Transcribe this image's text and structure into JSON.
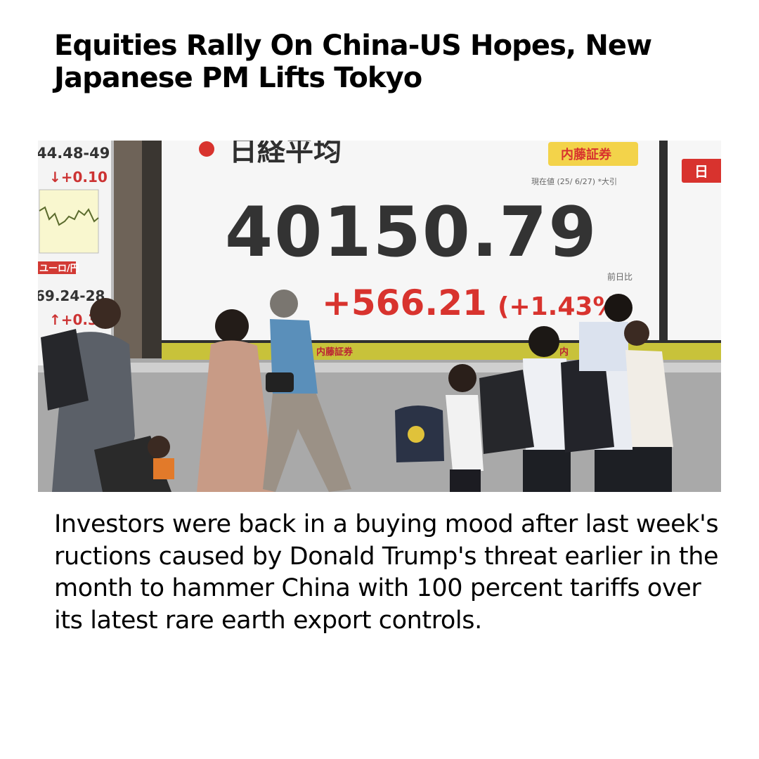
{
  "headline": "Equities Rally On China-US Hopes, New Japanese PM Lifts Tokyo",
  "photo": {
    "main_board": {
      "index_name": "日経平均",
      "broker_badge": "内藤証券",
      "timestamp": "現在値 (25/ 6/27) *大引",
      "value": "40150.79",
      "prev_day_label": "前日比",
      "change": "+566.21",
      "change_pct": "(+1.43%",
      "footer_badge": "内藤証券",
      "footer_badge_right": "内",
      "right_tag": "日"
    },
    "left_board": {
      "range1": "44.48-49",
      "delta1": "↓+0.10",
      "fx_label": "ユーロ/円",
      "range2": "69.24-28",
      "delta2": "↑+0.3"
    }
  },
  "body": "Investors were back in a buying mood after last week's ructions caused by Donald Trump's threat earlier in the month to hammer China with 100 percent tariffs over its latest rare earth export controls.",
  "colors": {
    "headline": "#000000",
    "board_number": "#2f2f2f",
    "board_change": "#d8332e",
    "broker_badge": "#f3d34a",
    "board_strip": "#c8c23a",
    "wall": "#a8a8a8"
  }
}
